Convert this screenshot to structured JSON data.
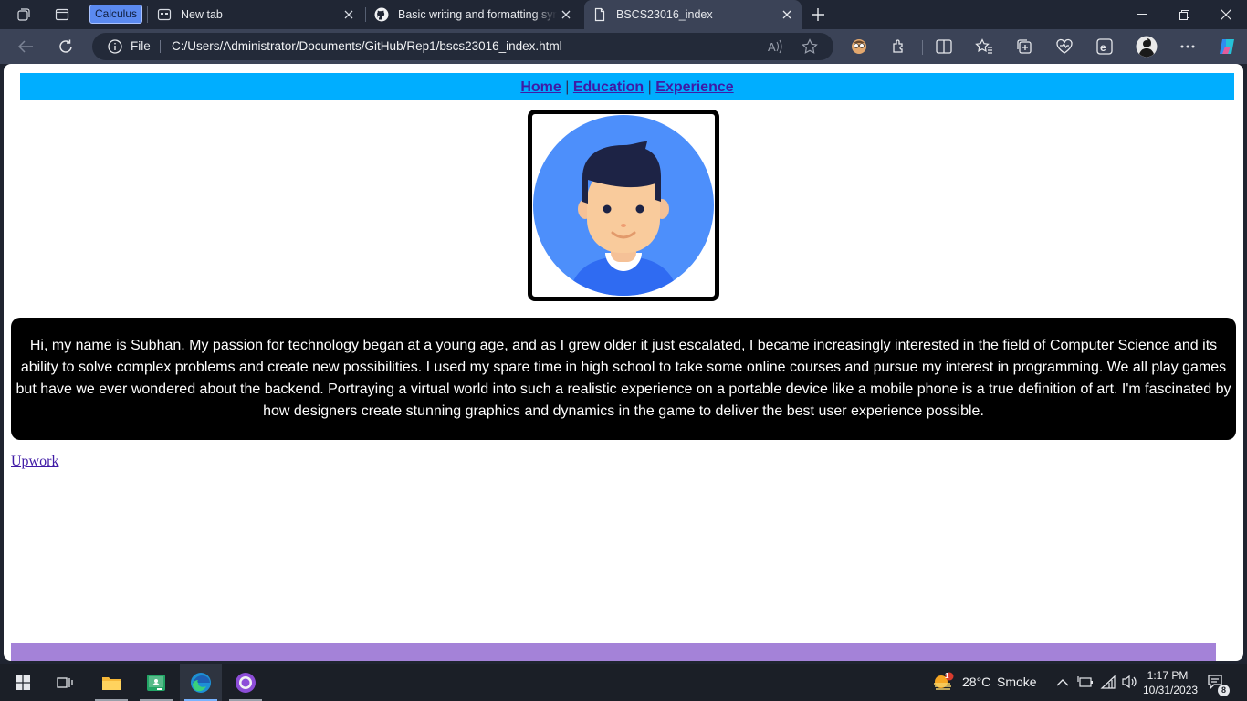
{
  "browser": {
    "workspace_tag": "Calculus",
    "tabs": [
      {
        "label": "New tab"
      },
      {
        "label": "Basic writing and formatting syntax"
      },
      {
        "label": "BSCS23016_index"
      }
    ],
    "address": {
      "scheme_label": "File",
      "url": "C:/Users/Administrator/Documents/GitHub/Rep1/bscs23016_index.html"
    }
  },
  "page": {
    "nav": {
      "home": "Home",
      "education": "Education",
      "experience": "Experience",
      "separator": "|"
    },
    "bio": "Hi, my name is Subhan. My passion for technology began at a young age, and as I grew older it just escalated, I became increasingly interested in the field of Computer Science and its ability to solve complex problems and create new possibilities. I used my spare time in high school to take some online courses and pursue my interest in programming. We all play games but have we ever wondered about the backend. Portraying a virtual world into such a realistic experience on a portable device like a mobile phone is a true definition of art. I'm fascinated by how designers create stunning graphics and dynamics in the game to deliver the best user experience possible.",
    "link_upwork": "Upwork",
    "colors": {
      "nav_bg": "#00aeff",
      "bio_bg": "#000000",
      "footer_bg": "#a482d8",
      "link": "#3f1aa6"
    }
  },
  "taskbar": {
    "weather": {
      "temp": "28°C",
      "condition": "Smoke",
      "badge": "1"
    },
    "clock": {
      "time": "1:17 PM",
      "date": "10/31/2023"
    },
    "notification_count": "8"
  }
}
